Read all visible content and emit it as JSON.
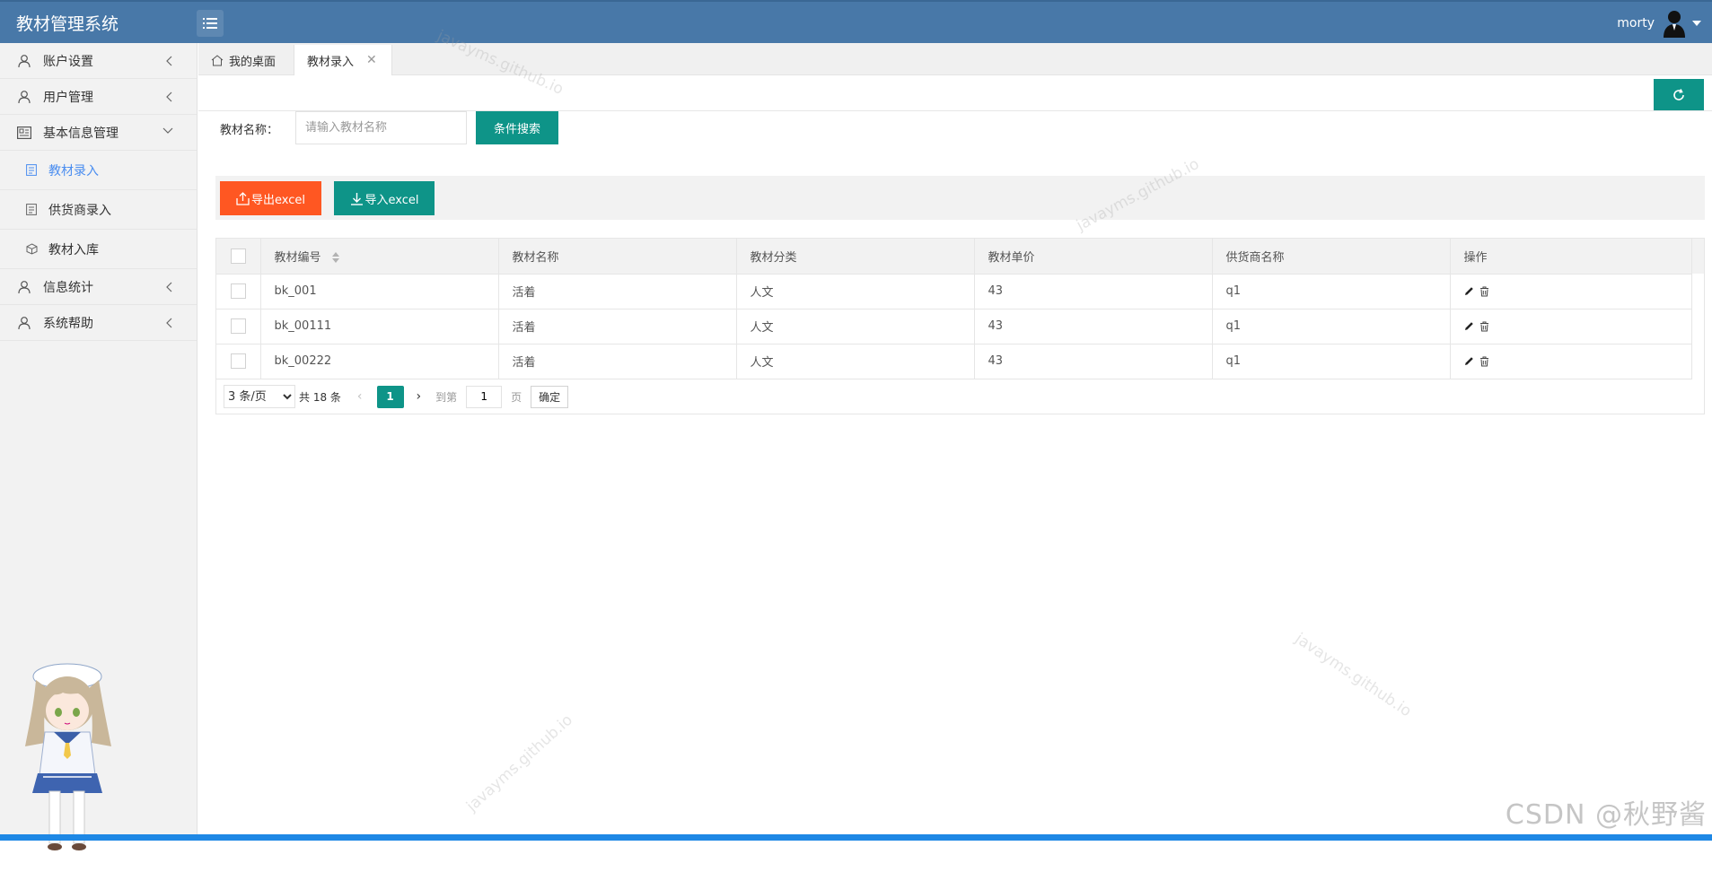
{
  "app": {
    "title": "教材管理系统",
    "user_name": "morty"
  },
  "sidebar": {
    "items": [
      {
        "label": "账户设置",
        "icon": "user-icon",
        "expanded": false
      },
      {
        "label": "用户管理",
        "icon": "user-icon",
        "expanded": false
      },
      {
        "label": "基本信息管理",
        "icon": "address-card-icon",
        "expanded": true,
        "children": [
          {
            "label": "教材录入",
            "icon": "form-icon",
            "active": true
          },
          {
            "label": "供货商录入",
            "icon": "form-icon",
            "active": false
          },
          {
            "label": "教材入库",
            "icon": "cube-icon",
            "active": false
          }
        ]
      },
      {
        "label": "信息统计",
        "icon": "user-icon",
        "expanded": false
      },
      {
        "label": "系统帮助",
        "icon": "user-icon",
        "expanded": false
      }
    ]
  },
  "tabs": [
    {
      "label": "我的桌面",
      "icon": "home-icon"
    },
    {
      "label": "教材录入",
      "active": true
    }
  ],
  "search": {
    "label": "教材名称：",
    "placeholder": "请输入教材名称",
    "button": "条件搜索"
  },
  "toolbar": {
    "export_label": "导出excel",
    "import_label": "导入excel"
  },
  "table": {
    "columns": [
      "教材编号",
      "教材名称",
      "教材分类",
      "教材单价",
      "供货商名称",
      "操作"
    ],
    "rows": [
      {
        "code": "bk_001",
        "name": "活着",
        "category": "人文",
        "price": "43",
        "supplier": "q1"
      },
      {
        "code": "bk_00111",
        "name": "活着",
        "category": "人文",
        "price": "43",
        "supplier": "q1"
      },
      {
        "code": "bk_00222",
        "name": "活着",
        "category": "人文",
        "price": "43",
        "supplier": "q1"
      }
    ]
  },
  "pager": {
    "page_size": "3 条/页",
    "total": "共 18 条",
    "current_page": "1",
    "goto_label": "到第",
    "goto_value": "1",
    "unit": "页",
    "confirm": "确定"
  },
  "watermark": "javayms.github.io",
  "corner_watermark": "CSDN @秋野酱",
  "colors": {
    "header": "#4878a8",
    "primary": "#0e9488",
    "danger": "#ff5722",
    "active_link": "#4a8df0"
  }
}
